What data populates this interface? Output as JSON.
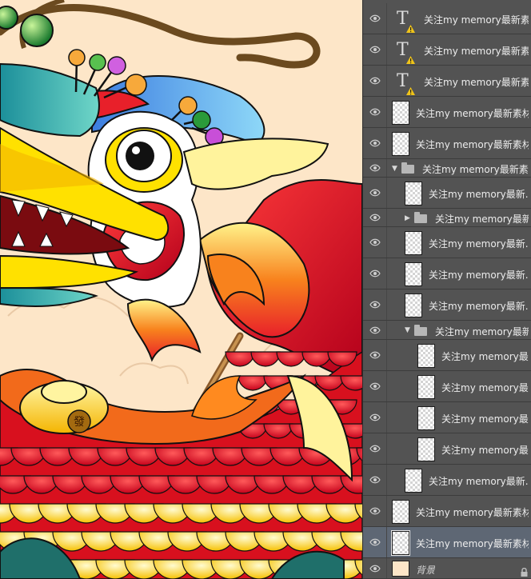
{
  "panel": {
    "layers": [
      {
        "name": "关注my memory最新素材",
        "kind": "text",
        "warning": true
      },
      {
        "name": "关注my memory最新素材",
        "kind": "text",
        "warning": true
      },
      {
        "name": "关注my memory最新素材",
        "kind": "text",
        "warning": true
      },
      {
        "name": "关注my memory最新素材",
        "kind": "pixel"
      },
      {
        "name": "关注my memory最新素材",
        "kind": "pixel"
      },
      {
        "name": "关注my memory最新素材",
        "kind": "group",
        "expanded": true
      },
      {
        "name": "关注my memory最新...",
        "kind": "pixel"
      },
      {
        "name": "关注my memory最新...",
        "kind": "group",
        "expanded": false
      },
      {
        "name": "关注my memory最新...",
        "kind": "pixel"
      },
      {
        "name": "关注my memory最新...",
        "kind": "pixel"
      },
      {
        "name": "关注my memory最新...",
        "kind": "pixel"
      },
      {
        "name": "关注my memory最新...",
        "kind": "group",
        "expanded": true
      },
      {
        "name": "关注my memory最...",
        "kind": "pixel"
      },
      {
        "name": "关注my memory最...",
        "kind": "pixel"
      },
      {
        "name": "关注my memory最...",
        "kind": "pixel"
      },
      {
        "name": "关注my memory最...",
        "kind": "pixel"
      },
      {
        "name": "关注my memory最新...",
        "kind": "pixel"
      },
      {
        "name": "关注my memory最新素材",
        "kind": "pixel"
      },
      {
        "name": "关注my memory最新素材",
        "kind": "pixel",
        "selected": true
      },
      {
        "name": "背景",
        "kind": "background",
        "locked": true
      }
    ]
  },
  "canvas": {
    "stamp_char": "發",
    "colors": {
      "background": "#fde6c8",
      "red": "#e8202a",
      "orange": "#f26a1b",
      "yellow": "#ffe100",
      "blue": "#3aa0e0",
      "outline": "#1a1a1a"
    }
  }
}
